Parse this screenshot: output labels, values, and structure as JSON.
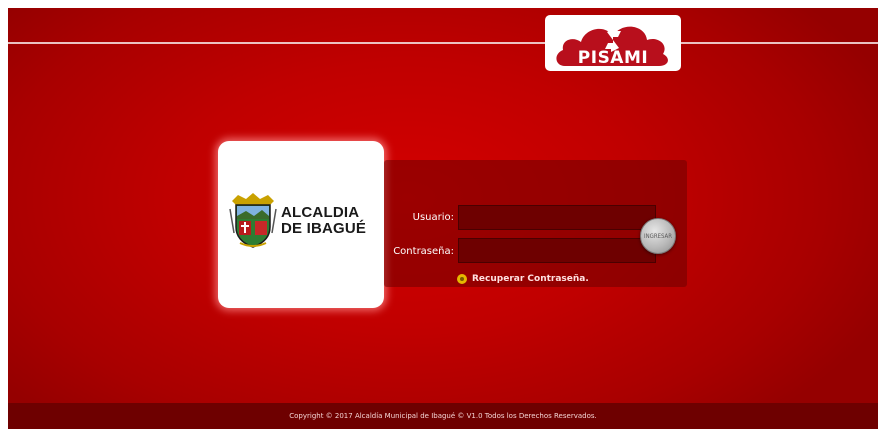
{
  "brand": {
    "name": "PISAMI",
    "color": "#b80f1c"
  },
  "logo": {
    "line1": "ALCALDIA",
    "line2": "DE IBAGUÉ",
    "icon": "coat-of-arms-icon"
  },
  "login": {
    "user_label": "Usuario:",
    "password_label": "Contraseña:",
    "user_value": "",
    "password_value": "",
    "submit_label": "INGRESAR",
    "recover_label": "Recuperar Contraseña."
  },
  "footer": {
    "text": "Copyright © 2017 Alcaldía Municipal de Ibagué © V1.0 Todos los Derechos Reservados."
  },
  "colors": {
    "background": "#c00000",
    "panel": "#6e0000",
    "footer": "#6e0000"
  }
}
